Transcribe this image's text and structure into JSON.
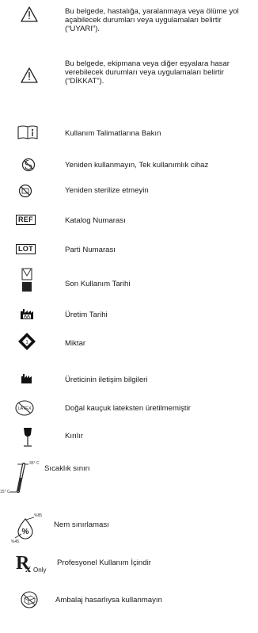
{
  "entries": [
    {
      "icon": "warning-triangle-icon",
      "text": "Bu belgede, hastalığa, yaralanmaya veya ölüme yol açabilecek durumları veya uygulamaları belirtir (“UYARI”)."
    },
    {
      "icon": "warning-triangle-icon",
      "text": "Bu belgede, ekipmana veya diğer eşyalara hasar verebilecek durumları veya uygulamaları belirtir (“DİKKAT”)."
    },
    {
      "icon": "consult-instructions-icon",
      "text": "Kullanım Talimatlarına Bakın"
    },
    {
      "icon": "do-not-reuse-icon",
      "text": "Yeniden kullanmayın, Tek kullanımlık cihaz"
    },
    {
      "icon": "do-not-resterilize-icon",
      "text": "Yeniden sterilize etmeyin"
    },
    {
      "icon": "ref-icon",
      "label": "REF",
      "text": "Katalog Numarası"
    },
    {
      "icon": "lot-icon",
      "label": "LOT",
      "text": "Parti Numarası"
    },
    {
      "icon": "hourglass-icon",
      "text": "Son Kullanım Tarihi"
    },
    {
      "icon": "factory-outline-icon",
      "text": "Üretim Tarihi"
    },
    {
      "icon": "quantity-diamond-icon",
      "text": "Miktar"
    },
    {
      "icon": "factory-filled-icon",
      "text": "Üreticinin iletişim bilgileri"
    },
    {
      "icon": "latex-free-icon",
      "label": "LATEX",
      "text": "Doğal kauçuk lateksten üretilmemiştir"
    },
    {
      "icon": "fragile-glass-icon",
      "text": "Kırılır"
    },
    {
      "icon": "thermometer-icon",
      "upper": "35° C",
      "lower": "15° C",
      "text": "Sıcaklık sınırı"
    },
    {
      "icon": "humidity-icon",
      "upper": "%85",
      "lower": "%45",
      "text": "Nem sınırlaması"
    },
    {
      "icon": "rx-only-icon",
      "rx": "R",
      "rx_sub": "Only",
      "text": "Profesyonel Kullanım İçindir"
    },
    {
      "icon": "damaged-package-icon",
      "text": "Ambalaj hasarlıysa kullanmayın"
    }
  ]
}
